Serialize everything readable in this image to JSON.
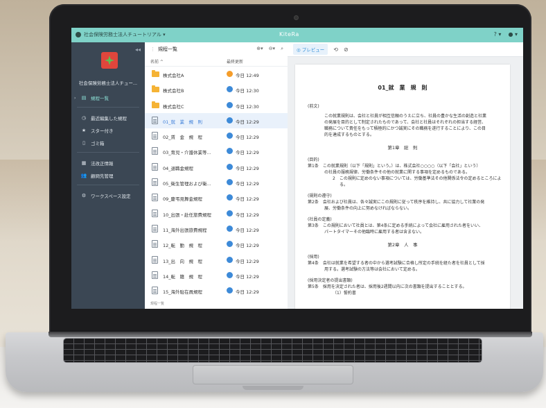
{
  "window": {
    "workspace_name": "社会保険労務士法人チュートリアル ▾",
    "brand": "KiteRa",
    "right_icons": [
      "? ▾",
      "● ▾"
    ]
  },
  "sidebar": {
    "org_name": "社会保険労務士法人チュー...",
    "items": [
      {
        "label": "規程一覧",
        "icon": "doc-list-icon",
        "active": true
      },
      {
        "label": "最近編集した規程",
        "icon": "clock-icon"
      },
      {
        "label": "スター付き",
        "icon": "star-icon"
      },
      {
        "label": "ゴミ箱",
        "icon": "trash-icon"
      },
      {
        "label": "法改正情報",
        "icon": "law-icon"
      },
      {
        "label": "顧問先管理",
        "icon": "people-icon"
      },
      {
        "label": "ワークスペース設定",
        "icon": "gear-icon"
      }
    ]
  },
  "list": {
    "title": "規程一覧",
    "col_name": "名前 ^",
    "col_updated": "最終更新",
    "footer": "規程一覧",
    "rows": [
      {
        "name": "株式会社A",
        "type": "folder",
        "time": "今日 12:49",
        "avatar": "orange"
      },
      {
        "name": "株式会社B",
        "type": "folder",
        "time": "今日 12:30",
        "avatar": "blue"
      },
      {
        "name": "株式会社C",
        "type": "folder",
        "time": "今日 12:30",
        "avatar": "blue"
      },
      {
        "name": "01_就　業　規　則",
        "type": "doc",
        "time": "今日 12:29",
        "avatar": "blue",
        "selected": true
      },
      {
        "name": "02_賃　金　規　程",
        "type": "doc",
        "time": "今日 12:29",
        "avatar": "blue"
      },
      {
        "name": "03_育児・介護休業等...",
        "type": "doc",
        "time": "今日 12:29",
        "avatar": "blue"
      },
      {
        "name": "04_退職金規程",
        "type": "doc",
        "time": "今日 12:29",
        "avatar": "blue"
      },
      {
        "name": "05_衛生管理および衛...",
        "type": "doc",
        "time": "今日 12:29",
        "avatar": "blue"
      },
      {
        "name": "09_慶弔見舞金規程",
        "type": "doc",
        "time": "今日 12:29",
        "avatar": "blue"
      },
      {
        "name": "10_出張・赴任旅費規程",
        "type": "doc",
        "time": "今日 12:29",
        "avatar": "blue"
      },
      {
        "name": "11_海外出張旅費規程",
        "type": "doc",
        "time": "今日 12:29",
        "avatar": "blue"
      },
      {
        "name": "12_転　勤　規　程",
        "type": "doc",
        "time": "今日 12:29",
        "avatar": "blue"
      },
      {
        "name": "13_出　向　規　程",
        "type": "doc",
        "time": "今日 12:29",
        "avatar": "blue"
      },
      {
        "name": "14_転　籍　規　程",
        "type": "doc",
        "time": "今日 12:29",
        "avatar": "blue"
      },
      {
        "name": "15_海外駐在員規程",
        "type": "doc",
        "time": "今日 12:29",
        "avatar": "blue"
      }
    ]
  },
  "preview": {
    "tab_label": "◎ プレビュー",
    "doc_title": "01_就　業　規　則",
    "lines": [
      "(前文)",
      "この就業規則は、会社と社員が相互信頼のうえに立ち、社員の豊かな生活の創造と社業",
      "の発展を目的として制定されたものであって、会社と社員はそれぞれの担当する経営、",
      "職務について責任をもって積極的にかつ誠実にその職務を遂行することにより、この目",
      "的を達成するものとする。",
      "第1章　総　則",
      "(目的)",
      "第1条　この就業規則（以下「規則」という。）は、株式会社○○○○（以下「会社」という）",
      "の社員の服務規律、労働条件その他の就業に関する事項を定めるものである。",
      "2　この規則に定めのない事項については、労働基準法その他関係法令の定めるところによ",
      "る。",
      "(規則の遵守)",
      "第2条　会社および社員は、各々誠実にこの規則に従って秩序を維持し、共に協力して社業の発",
      "展、労働条件の向上に努めなければならない。",
      "(社員の定義)",
      "第3条　この規則において社員とは、第4条に定める手続によって会社に雇用された者をいい、",
      "パートタイマーその他臨時に雇用する者は含まない。",
      "第2章　人　事",
      "(採用)",
      "第4条　会社は就業を希望する者の中から選考試験に合格し所定の手続を経た者を社員として採",
      "用する。選考試験の方法等は会社において定める。",
      "(採用決定者の提出書類)",
      "第5条　採用を決定された者は、採用後2週間以内に次の書類を提出することとする。",
      "（1）誓約書"
    ]
  }
}
